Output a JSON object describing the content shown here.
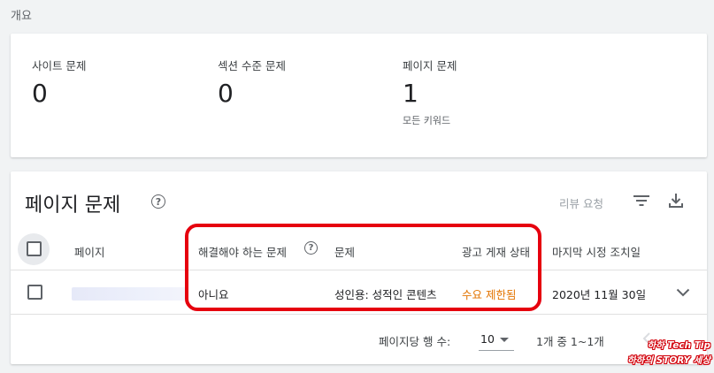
{
  "overview": {
    "title": "개요",
    "stats": [
      {
        "label": "사이트 문제",
        "value": "0"
      },
      {
        "label": "섹션 수준 문제",
        "value": "0"
      },
      {
        "label": "페이지 문제",
        "value": "1",
        "sub": "모든 키워드"
      }
    ]
  },
  "issues": {
    "title": "페이지 문제",
    "review_button": "리뷰 요청",
    "icons": {
      "help": "help-circle-icon",
      "filter": "filter-icon",
      "download": "download-icon"
    },
    "columns": {
      "page": "페이지",
      "must_fix": "해결해야 하는 문제",
      "issue": "문제",
      "ad_status": "광고 게재 상태",
      "last_action": "마지막 시정 조치일"
    },
    "rows": [
      {
        "must_fix": "아니요",
        "issue": "성인용: 성적인 콘텐츠",
        "ad_status": "수요 제한됨",
        "last_action": "2020년 11월 30일"
      }
    ],
    "pagination": {
      "rows_per_page_label": "페이지당 행 수:",
      "rows_per_page": "10",
      "range": "1개 중 1~1개"
    }
  },
  "colors": {
    "ad_status": "#e37400",
    "highlight": "#e6000e"
  },
  "watermark": {
    "line1": "하하 Tech Tip",
    "line2": "하하의 STORY 세상"
  }
}
